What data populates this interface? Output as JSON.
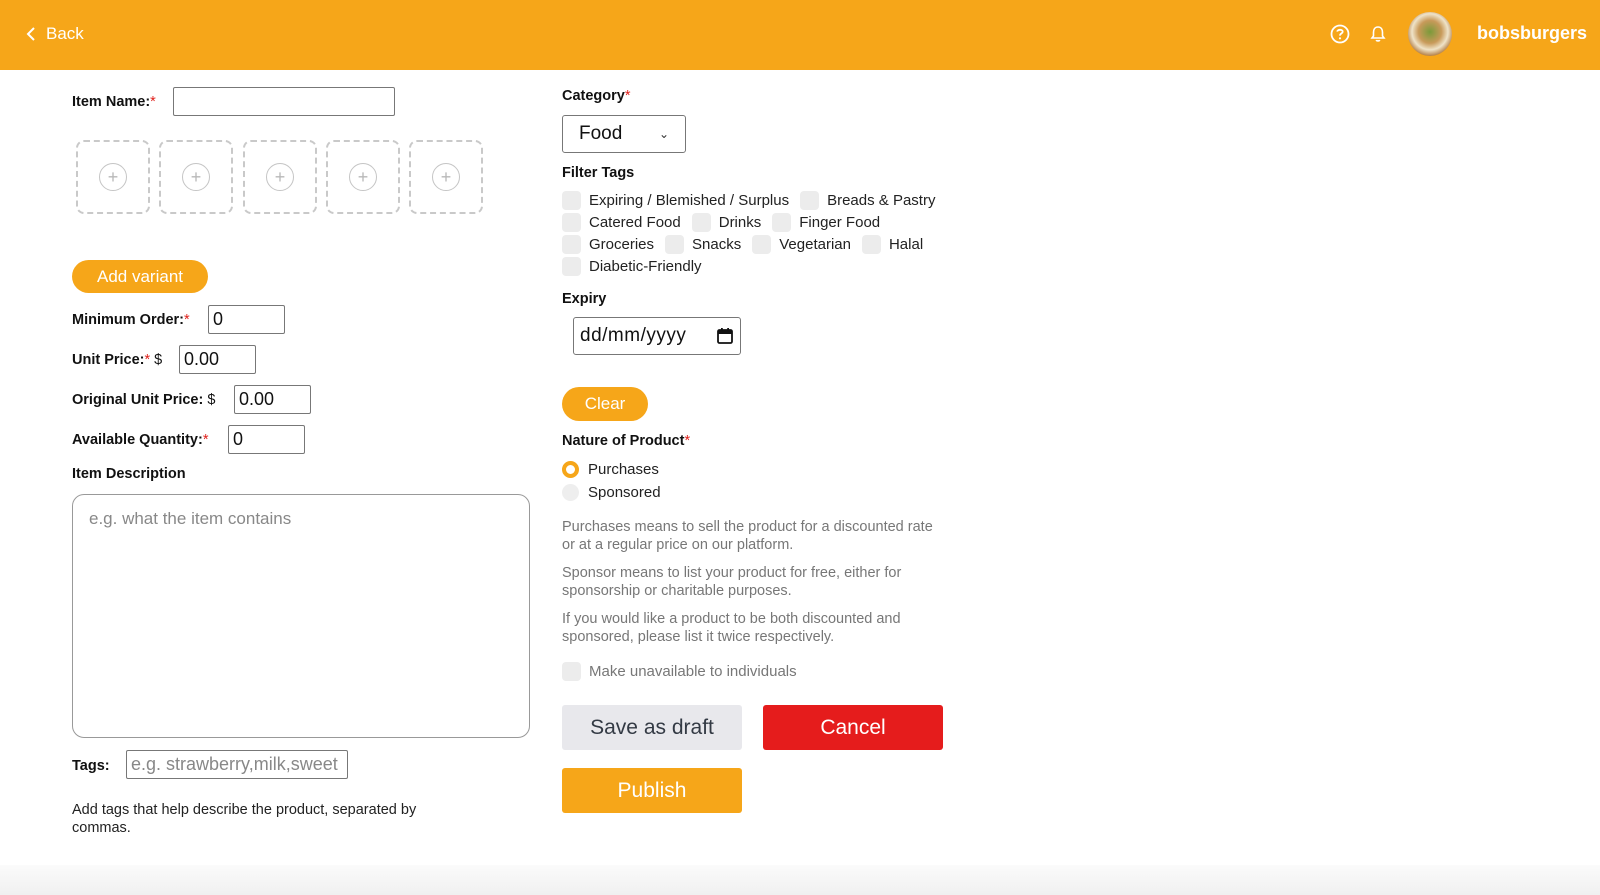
{
  "header": {
    "back_label": "Back",
    "help_icon": "help-circle-icon",
    "bell_icon": "bell-icon",
    "username": "bobsburgers",
    "accent_color": "#f6a619"
  },
  "left": {
    "item_name_label": "Item Name:",
    "required_mark": "*",
    "add_image_glyph": "+",
    "add_variant_label": "Add variant",
    "minimum_order_label": "Minimum Order:",
    "minimum_order_value": "0",
    "unit_price_label": "Unit Price:",
    "currency": "$",
    "unit_price_value": "0.00",
    "original_unit_price_label": "Original Unit Price:",
    "original_unit_price_value": "0.00",
    "available_quantity_label": "Available Quantity:",
    "available_quantity_value": "0",
    "item_description_label": "Item Description",
    "item_description_placeholder": "e.g. what the item contains",
    "tags_label": "Tags:",
    "tags_placeholder": "e.g. strawberry,milk,sweet",
    "tags_help": "Add tags that help describe the product, separated by commas."
  },
  "right": {
    "category_label": "Category",
    "category_value": "Food",
    "filter_tags_label": "Filter Tags",
    "filter_tags_rows": [
      [
        "Expiring / Blemished / Surplus",
        "Breads & Pastry"
      ],
      [
        "Catered Food",
        "Drinks",
        "Finger Food"
      ],
      [
        "Groceries",
        "Snacks",
        "Vegetarian",
        "Halal"
      ],
      [
        "Diabetic-Friendly"
      ]
    ],
    "expiry_label": "Expiry",
    "expiry_placeholder": "dd/mm/yyyy",
    "clear_label": "Clear",
    "nature_label": "Nature of Product",
    "nature_options": [
      "Purchases",
      "Sponsored"
    ],
    "nature_selected": "Purchases",
    "note_purchases": "Purchases means to sell the product for a discounted rate or at a regular price on our platform.",
    "note_sponsor": "Sponsor means to list your product for free, either for sponsorship or charitable purposes.",
    "note_both": "If you would like a product to be both discounted and sponsored, please list it twice respectively.",
    "unavailable_label": "Make unavailable to individuals",
    "save_draft_label": "Save as draft",
    "cancel_label": "Cancel",
    "publish_label": "Publish",
    "cancel_color": "#e51c1c"
  }
}
